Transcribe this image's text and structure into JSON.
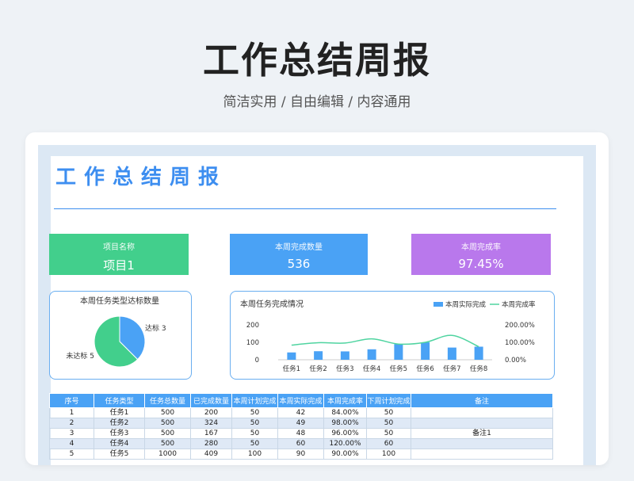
{
  "header": {
    "title": "工作总结周报",
    "subtitle": "简洁实用 / 自由编辑 / 内容通用"
  },
  "sheet": {
    "title": "工作总结周报",
    "kpis": [
      {
        "label": "项目名称",
        "value": "项目1"
      },
      {
        "label": "本周完成数量",
        "value": "536"
      },
      {
        "label": "本周完成率",
        "value": "97.45%"
      }
    ]
  },
  "colors": {
    "accent": "#3d8ef0",
    "green": "#42cf8c",
    "blue": "#4aa2f5",
    "purple": "#b978ec",
    "line": "#4fd4a0"
  },
  "chart_data": [
    {
      "type": "pie",
      "title": "本周任务类型达标数量",
      "labels": [
        "达标",
        "未达标"
      ],
      "values": [
        3,
        5
      ],
      "slice_labels": [
        "达标 3",
        "未达标 5"
      ]
    },
    {
      "type": "bar",
      "title": "本周任务完成情况",
      "categories": [
        "任务1",
        "任务2",
        "任务3",
        "任务4",
        "任务5",
        "任务6",
        "任务7",
        "任务8"
      ],
      "series": [
        {
          "name": "本周实际完成",
          "type": "bar",
          "axis": "left",
          "values": [
            42,
            49,
            48,
            60,
            90,
            100,
            70,
            75
          ]
        },
        {
          "name": "本周完成率",
          "type": "line",
          "axis": "right",
          "values": [
            84,
            98,
            96,
            120,
            90,
            100,
            140,
            75
          ]
        }
      ],
      "y_left_ticks": [
        "200",
        "100",
        "0"
      ],
      "y_right_ticks": [
        "200.00%",
        "100.00%",
        "0.00%"
      ],
      "ylim_left": [
        0,
        200
      ],
      "ylim_right": [
        0,
        200
      ],
      "legend": "top-right"
    }
  ],
  "table": {
    "headers": [
      "序号",
      "任务类型",
      "任务总数量",
      "已完成数量",
      "本周计划完成",
      "本周实际完成",
      "本周完成率",
      "下周计划完成",
      "备注"
    ],
    "rows": [
      [
        "1",
        "任务1",
        "500",
        "200",
        "50",
        "42",
        "84.00%",
        "50",
        ""
      ],
      [
        "2",
        "任务2",
        "500",
        "324",
        "50",
        "49",
        "98.00%",
        "50",
        ""
      ],
      [
        "3",
        "任务3",
        "500",
        "167",
        "50",
        "48",
        "96.00%",
        "50",
        "备注1"
      ],
      [
        "4",
        "任务4",
        "500",
        "280",
        "50",
        "60",
        "120.00%",
        "60",
        ""
      ],
      [
        "5",
        "任务5",
        "1000",
        "409",
        "100",
        "90",
        "90.00%",
        "100",
        ""
      ]
    ]
  }
}
